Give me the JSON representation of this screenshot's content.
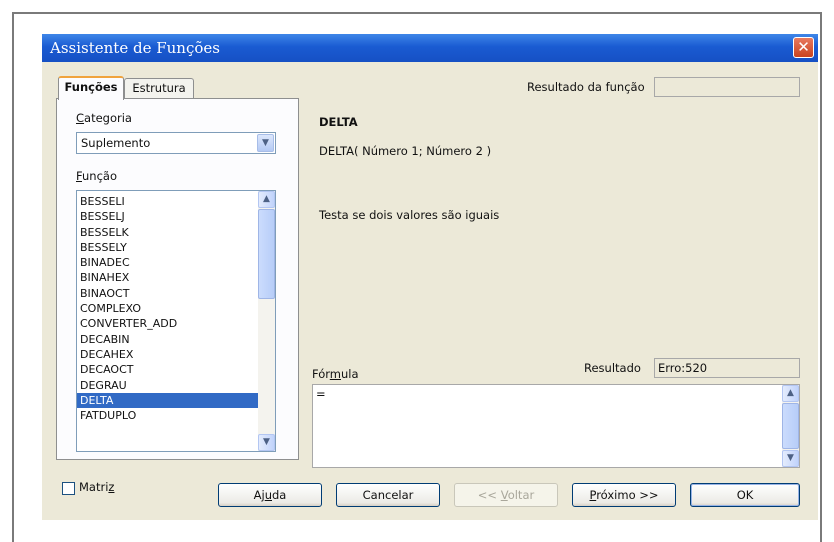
{
  "window": {
    "title": "Assistente de Funções",
    "close_glyph": "✕"
  },
  "tabs": [
    {
      "label": "Funções",
      "active": true
    },
    {
      "label": "Estrutura",
      "active": false
    }
  ],
  "category": {
    "label_first": "C",
    "label_rest": "ategoria",
    "selected": "Suplemento"
  },
  "function_list": {
    "label_first": "F",
    "label_rest": "unção",
    "items": [
      "BESSELI",
      "BESSELJ",
      "BESSELK",
      "BESSELY",
      "BINADEC",
      "BINAHEX",
      "BINAOCT",
      "COMPLEXO",
      "CONVERTER_ADD",
      "DECABIN",
      "DECAHEX",
      "DECAOCT",
      "DEGRAU",
      "DELTA",
      "FATDUPLO"
    ],
    "selected": "DELTA"
  },
  "function_result": {
    "label": "Resultado da função",
    "value": ""
  },
  "details": {
    "name": "DELTA",
    "syntax": "DELTA( Número 1; Número 2 )",
    "description": "Testa se dois valores são iguais"
  },
  "formula": {
    "label_pre": "Fór",
    "label_u": "m",
    "label_post": "ula",
    "value": "=",
    "result_label": "Resultado",
    "result_value": "Erro:520"
  },
  "matrix": {
    "label_pre": "Matri",
    "label_u": "z",
    "checked": false
  },
  "buttons": {
    "help": {
      "pre": "Aj",
      "u": "u",
      "post": "da"
    },
    "cancel": {
      "label": "Cancelar"
    },
    "back": {
      "pre": "<< ",
      "u": "V",
      "post": "oltar",
      "disabled": true
    },
    "next": {
      "pre": "",
      "u": "P",
      "post": "róximo >>"
    },
    "ok": {
      "label": "OK"
    }
  },
  "colors": {
    "titlebar": "#1a5bd2",
    "selection": "#316ac5",
    "dialog_bg": "#ece9d8"
  }
}
